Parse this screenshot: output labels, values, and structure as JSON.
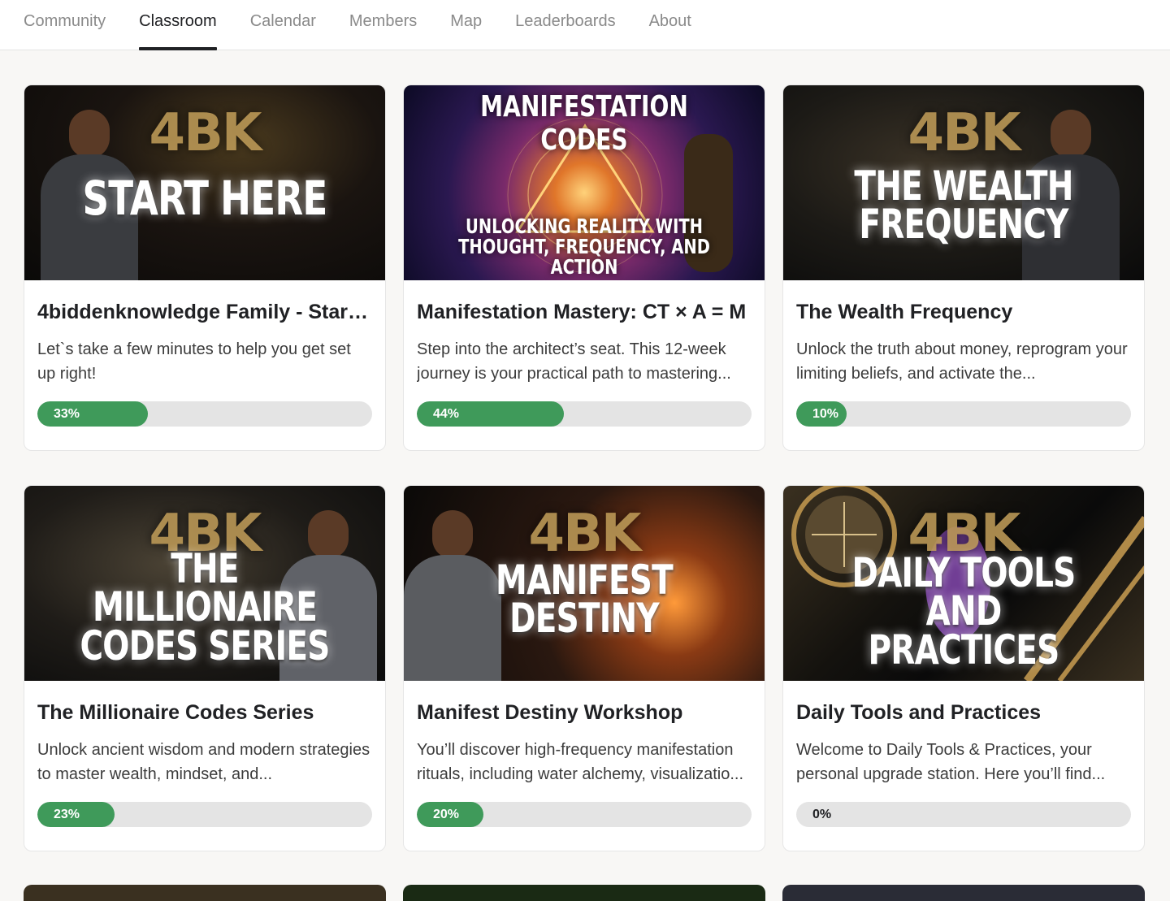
{
  "nav": {
    "tabs": [
      {
        "label": "Community",
        "active": false
      },
      {
        "label": "Classroom",
        "active": true
      },
      {
        "label": "Calendar",
        "active": false
      },
      {
        "label": "Members",
        "active": false
      },
      {
        "label": "Map",
        "active": false
      },
      {
        "label": "Leaderboards",
        "active": false
      },
      {
        "label": "About",
        "active": false
      }
    ]
  },
  "courses": [
    {
      "title": "4biddenknowledge Family - Start ...",
      "description": "Let`s take a few minutes to help you get set up right!",
      "progress": 33,
      "progress_label": "33%",
      "thumb": {
        "brand": "4BK",
        "headline": "START HERE"
      }
    },
    {
      "title": "Manifestation Mastery: CT × A = M",
      "description": "Step into the architect’s seat. This 12-week journey is your practical path to mastering...",
      "progress": 44,
      "progress_label": "44%",
      "thumb": {
        "topline": "MANIFESTATION CODES",
        "bottomline": "UNLOCKING REALITY WITH THOUGHT, FREQUENCY, AND ACTION"
      }
    },
    {
      "title": "The Wealth Frequency",
      "description": "Unlock the truth about money, reprogram your limiting beliefs, and activate the...",
      "progress": 10,
      "progress_label": "10%",
      "thumb": {
        "brand": "4BK",
        "headline": "THE WEALTH FREQUENCY"
      }
    },
    {
      "title": "The Millionaire Codes Series",
      "description": "Unlock ancient wisdom and modern strategies to master wealth, mindset, and...",
      "progress": 23,
      "progress_label": "23%",
      "thumb": {
        "brand": "4BK",
        "headline": "THE MILLIONAIRE CODES SERIES"
      }
    },
    {
      "title": "Manifest Destiny Workshop",
      "description": "You’ll discover high-frequency manifestation rituals, including water alchemy, visualizatio...",
      "progress": 20,
      "progress_label": "20%",
      "thumb": {
        "brand": "4BK",
        "headline": "MANIFEST DESTINY"
      }
    },
    {
      "title": "Daily Tools and Practices",
      "description": "Welcome to Daily Tools & Practices, your personal upgrade station. Here you’ll find...",
      "progress": 0,
      "progress_label": "0%",
      "thumb": {
        "brand": "4BK",
        "headline": "DAILY TOOLS AND PRACTICES"
      }
    }
  ],
  "colors": {
    "progress_fill": "#3f9a5a",
    "progress_track": "#e4e4e4",
    "active_tab": "#202124",
    "inactive_tab": "#8a8a8a"
  }
}
